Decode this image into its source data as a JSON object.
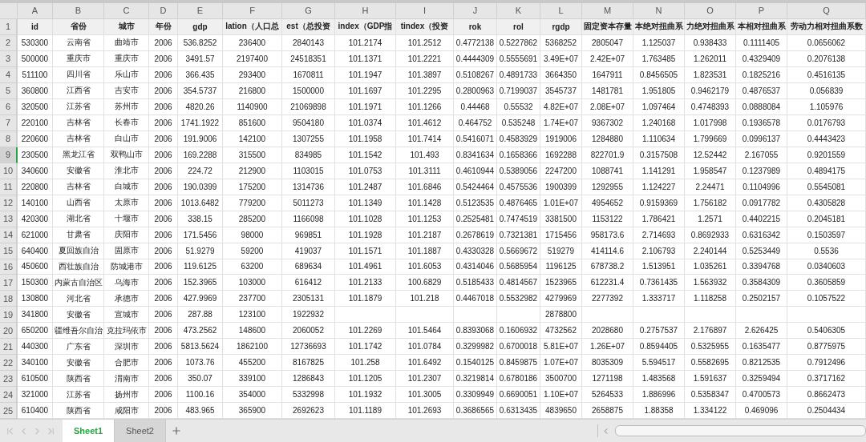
{
  "sheet": {
    "column_letters": [
      "A",
      "B",
      "C",
      "D",
      "E",
      "F",
      "G",
      "H",
      "I",
      "J",
      "K",
      "L",
      "M",
      "N",
      "O",
      "P",
      "Q"
    ],
    "header_row": {
      "number": "1",
      "cells": [
        "id",
        "省份",
        "城市",
        "年份",
        "gdp",
        "lation（人口总",
        "est（总投资",
        "index（GDP指",
        "tindex（投资",
        "rok",
        "rol",
        "rgdp",
        "固定资本存量",
        "本绝对扭曲系",
        "力绝对扭曲系",
        "本相对扭曲系",
        "劳动力相对扭曲系数"
      ]
    },
    "rows": [
      {
        "number": "2",
        "selected": false,
        "cells": [
          "530300",
          "云南省",
          "曲靖市",
          "2006",
          "536.8252",
          "236400",
          "2840143",
          "101.2174",
          "101.2512",
          "0.4772138",
          "0.5227862",
          "5368252",
          "2805047",
          "1.125037",
          "0.938433",
          "0.1111405",
          "0.0656062"
        ]
      },
      {
        "number": "3",
        "selected": false,
        "cells": [
          "500000",
          "重庆市",
          "重庆市",
          "2006",
          "3491.57",
          "2197400",
          "24518351",
          "101.1371",
          "101.2221",
          "0.4444309",
          "0.5555691",
          "3.49E+07",
          "2.42E+07",
          "1.763485",
          "1.262011",
          "0.4329409",
          "0.2076138"
        ]
      },
      {
        "number": "4",
        "selected": false,
        "cells": [
          "511100",
          "四川省",
          "乐山市",
          "2006",
          "366.435",
          "293400",
          "1670811",
          "101.1947",
          "101.3897",
          "0.5108267",
          "0.4891733",
          "3664350",
          "1647911",
          "0.8456505",
          "1.823531",
          "0.1825216",
          "0.4516135"
        ]
      },
      {
        "number": "5",
        "selected": false,
        "cells": [
          "360800",
          "江西省",
          "吉安市",
          "2006",
          "354.5737",
          "216800",
          "1500000",
          "101.1697",
          "101.2295",
          "0.2800963",
          "0.7199037",
          "3545737",
          "1481781",
          "1.951805",
          "0.9462179",
          "0.4876537",
          "0.056839"
        ]
      },
      {
        "number": "6",
        "selected": false,
        "cells": [
          "320500",
          "江苏省",
          "苏州市",
          "2006",
          "4820.26",
          "1140900",
          "21069898",
          "101.1971",
          "101.1266",
          "0.44468",
          "0.55532",
          "4.82E+07",
          "2.08E+07",
          "1.097464",
          "0.4748393",
          "0.0888084",
          "1.105976"
        ]
      },
      {
        "number": "7",
        "selected": false,
        "cells": [
          "220100",
          "吉林省",
          "长春市",
          "2006",
          "1741.1922",
          "851600",
          "9504180",
          "101.0374",
          "101.4612",
          "0.464752",
          "0.535248",
          "1.74E+07",
          "9367302",
          "1.240168",
          "1.017998",
          "0.1936578",
          "0.0176793"
        ]
      },
      {
        "number": "8",
        "selected": false,
        "cells": [
          "220600",
          "吉林省",
          "白山市",
          "2006",
          "191.9006",
          "142100",
          "1307255",
          "101.1958",
          "101.7414",
          "0.5416071",
          "0.4583929",
          "1919006",
          "1284880",
          "1.110634",
          "1.799669",
          "0.0996137",
          "0.4443423"
        ]
      },
      {
        "number": "9",
        "selected": true,
        "cells": [
          "230500",
          "黑龙江省",
          "双鸭山市",
          "2006",
          "169.2288",
          "315500",
          "834985",
          "101.1542",
          "101.493",
          "0.8341634",
          "0.1658366",
          "1692288",
          "822701.9",
          "0.3157508",
          "12.52442",
          "2.167055",
          "0.9201559"
        ]
      },
      {
        "number": "10",
        "selected": false,
        "cells": [
          "340600",
          "安徽省",
          "淮北市",
          "2006",
          "224.72",
          "212900",
          "1103015",
          "101.0753",
          "101.3111",
          "0.4610944",
          "0.5389056",
          "2247200",
          "1088741",
          "1.141291",
          "1.958547",
          "0.1237989",
          "0.4894175"
        ]
      },
      {
        "number": "11",
        "selected": false,
        "cells": [
          "220800",
          "吉林省",
          "白城市",
          "2006",
          "190.0399",
          "175200",
          "1314736",
          "101.2487",
          "101.6846",
          "0.5424464",
          "0.4575536",
          "1900399",
          "1292955",
          "1.124227",
          "2.24471",
          "0.1104996",
          "0.5545081"
        ]
      },
      {
        "number": "12",
        "selected": false,
        "cells": [
          "140100",
          "山西省",
          "太原市",
          "2006",
          "1013.6482",
          "779200",
          "5011273",
          "101.1349",
          "101.1428",
          "0.5123535",
          "0.4876465",
          "1.01E+07",
          "4954652",
          "0.9159369",
          "1.756182",
          "0.0917782",
          "0.4305828"
        ]
      },
      {
        "number": "13",
        "selected": false,
        "cells": [
          "420300",
          "湖北省",
          "十堰市",
          "2006",
          "338.15",
          "285200",
          "1166098",
          "101.1028",
          "101.1253",
          "0.2525481",
          "0.7474519",
          "3381500",
          "1153122",
          "1.786421",
          "1.2571",
          "0.4402215",
          "0.2045181"
        ]
      },
      {
        "number": "14",
        "selected": false,
        "cells": [
          "621000",
          "甘肃省",
          "庆阳市",
          "2006",
          "171.5456",
          "98000",
          "969851",
          "101.1928",
          "101.2187",
          "0.2678619",
          "0.7321381",
          "1715456",
          "958173.6",
          "2.714693",
          "0.8692933",
          "0.6316342",
          "0.1503597"
        ]
      },
      {
        "number": "15",
        "selected": false,
        "cells": [
          "640400",
          "夏回族自治",
          "固原市",
          "2006",
          "51.9279",
          "59200",
          "419037",
          "101.1571",
          "101.1887",
          "0.4330328",
          "0.5669672",
          "519279",
          "414114.6",
          "2.106793",
          "2.240144",
          "0.5253449",
          "0.5536"
        ]
      },
      {
        "number": "16",
        "selected": false,
        "cells": [
          "450600",
          "西壮族自治",
          "防城港市",
          "2006",
          "119.6125",
          "63200",
          "689634",
          "101.4961",
          "101.6053",
          "0.4314046",
          "0.5685954",
          "1196125",
          "678738.2",
          "1.513951",
          "1.035261",
          "0.3394768",
          "0.0340603"
        ]
      },
      {
        "number": "17",
        "selected": false,
        "cells": [
          "150300",
          "内蒙古自治区",
          "乌海市",
          "2006",
          "152.3965",
          "103000",
          "616412",
          "101.2133",
          "100.6829",
          "0.5185433",
          "0.4814567",
          "1523965",
          "612231.4",
          "0.7361435",
          "1.563932",
          "0.3584309",
          "0.3605859"
        ]
      },
      {
        "number": "18",
        "selected": false,
        "cells": [
          "130800",
          "河北省",
          "承德市",
          "2006",
          "427.9969",
          "237700",
          "2305131",
          "101.1879",
          "101.218",
          "0.4467018",
          "0.5532982",
          "4279969",
          "2277392",
          "1.333717",
          "1.118258",
          "0.2502157",
          "0.1057522"
        ]
      },
      {
        "number": "19",
        "selected": false,
        "cells": [
          "341800",
          "安徽省",
          "宣城市",
          "2006",
          "287.88",
          "123100",
          "1922932",
          null,
          null,
          null,
          null,
          "2878800",
          null,
          null,
          null,
          null,
          null
        ]
      },
      {
        "number": "20",
        "selected": false,
        "cells": [
          "650200",
          "疆维吾尔自治",
          "克拉玛依市",
          "2006",
          "473.2562",
          "148600",
          "2060052",
          "101.2269",
          "101.5464",
          "0.8393068",
          "0.1606932",
          "4732562",
          "2028680",
          "0.2757537",
          "2.176897",
          "2.626425",
          "0.5406305"
        ]
      },
      {
        "number": "21",
        "selected": false,
        "cells": [
          "440300",
          "广东省",
          "深圳市",
          "2006",
          "5813.5624",
          "1862100",
          "12736693",
          "101.1742",
          "101.0784",
          "0.3299982",
          "0.6700018",
          "5.81E+07",
          "1.26E+07",
          "0.8594405",
          "0.5325955",
          "0.1635477",
          "0.8775975"
        ]
      },
      {
        "number": "22",
        "selected": false,
        "cells": [
          "340100",
          "安徽省",
          "合肥市",
          "2006",
          "1073.76",
          "455200",
          "8167825",
          "101.258",
          "101.6492",
          "0.1540125",
          "0.8459875",
          "1.07E+07",
          "8035309",
          "5.594517",
          "0.5582695",
          "0.8212535",
          "0.7912496"
        ]
      },
      {
        "number": "23",
        "selected": false,
        "cells": [
          "610500",
          "陕西省",
          "渭南市",
          "2006",
          "350.07",
          "339100",
          "1286843",
          "101.1205",
          "101.2307",
          "0.3219814",
          "0.6780186",
          "3500700",
          "1271198",
          "1.483568",
          "1.591637",
          "0.3259494",
          "0.3717162"
        ]
      },
      {
        "number": "24",
        "selected": false,
        "cells": [
          "321000",
          "江苏省",
          "扬州市",
          "2006",
          "1100.16",
          "354000",
          "5332998",
          "101.1932",
          "101.3005",
          "0.3309949",
          "0.6690051",
          "1.10E+07",
          "5264533",
          "1.886996",
          "0.5358347",
          "0.4700573",
          "0.8662473"
        ]
      },
      {
        "number": "25",
        "selected": false,
        "cells": [
          "610400",
          "陕西省",
          "咸阳市",
          "2006",
          "483.965",
          "365900",
          "2692623",
          "101.1189",
          "101.2693",
          "0.3686565",
          "0.6313435",
          "4839650",
          "2658875",
          "1.88358",
          "1.334122",
          "0.469096",
          "0.2504434"
        ]
      }
    ]
  },
  "sheet_tabs": [
    {
      "label": "Sheet1",
      "selected": true
    },
    {
      "label": "Sheet2",
      "selected": false
    }
  ]
}
